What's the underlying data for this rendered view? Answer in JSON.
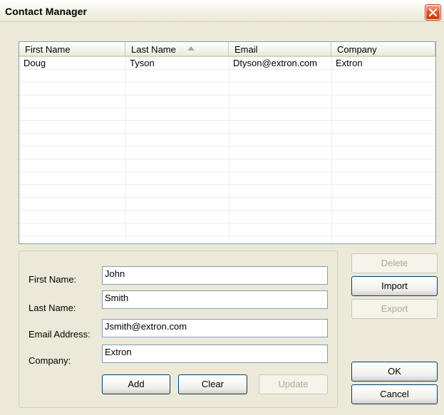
{
  "window": {
    "title": "Contact Manager"
  },
  "list": {
    "columns": [
      "First Name",
      "Last Name",
      "Email",
      "Company"
    ],
    "rows": [
      {
        "first": "Doug",
        "last": "Tyson",
        "email": "Dtyson@extron.com",
        "company": "Extron"
      }
    ],
    "sorted_column": "Last Name",
    "sort_direction": "ascending"
  },
  "form": {
    "first_name_label": "First Name:",
    "first_name_value": "John",
    "last_name_label": "Last Name:",
    "last_name_value": "Smith",
    "email_label": "Email Address:",
    "email_value": "Jsmith@extron.com",
    "company_label": "Company:",
    "company_value": "Extron",
    "add_label": "Add",
    "clear_label": "Clear",
    "update_label": "Update"
  },
  "side_buttons": {
    "delete_label": "Delete",
    "import_label": "Import",
    "export_label": "Export",
    "ok_label": "OK",
    "cancel_label": "Cancel"
  },
  "icons": {
    "close": "close-icon",
    "sort": "sort-ascending-icon"
  },
  "colors": {
    "close_button": "#e05a2c",
    "list_border": "#7f9db9",
    "window_bg": "#ece9d8"
  }
}
